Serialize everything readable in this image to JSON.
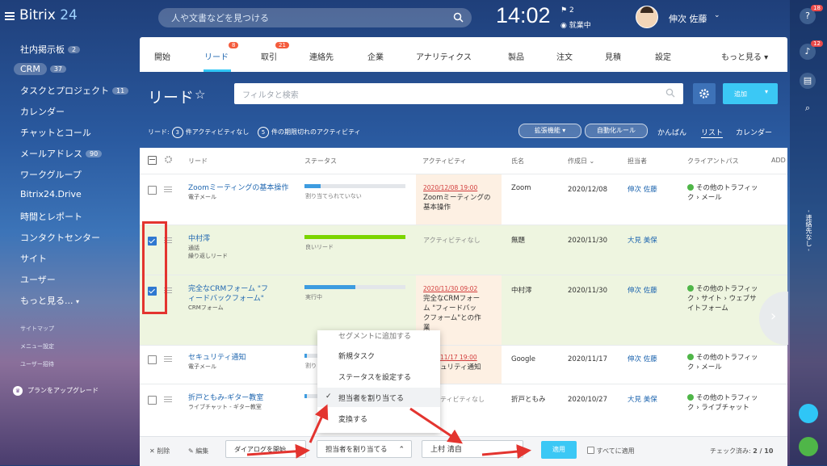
{
  "colors": {
    "accent": "#2fc6f6",
    "link": "#2067b0",
    "badge": "#f45b3c",
    "annotation": "#e3342f"
  },
  "topbar": {
    "app_name": "Bitrix",
    "app_version": "24",
    "search_placeholder": "人や文書などを見つける",
    "clock": "14:02",
    "flag_count": "2",
    "work_status": "就業中",
    "user_name": "伸次 佐藤"
  },
  "sidebar": {
    "items": [
      {
        "label": "社内掲示板",
        "count": "2"
      },
      {
        "label": "CRM",
        "count": "37"
      },
      {
        "label": "タスクとプロジェクト",
        "count": "11"
      },
      {
        "label": "カレンダー",
        "count": ""
      },
      {
        "label": "チャットとコール",
        "count": ""
      },
      {
        "label": "メールアドレス",
        "count": "90"
      },
      {
        "label": "ワークグループ",
        "count": ""
      },
      {
        "label": "Bitrix24.Drive",
        "count": ""
      },
      {
        "label": "時間とレポート",
        "count": ""
      },
      {
        "label": "コンタクトセンター",
        "count": ""
      },
      {
        "label": "サイト",
        "count": ""
      },
      {
        "label": "ユーザー",
        "count": ""
      },
      {
        "label": "もっと見る...",
        "count": ""
      }
    ],
    "sitemap": "サイトマップ",
    "menu_settings": "メニュー設定",
    "user_invite": "ユーザー招待",
    "upgrade": "プランをアップグレード"
  },
  "rightbar": {
    "help_count": "18",
    "notify_count": "12",
    "vertical_label": "- 連絡先なし -"
  },
  "tabs": [
    {
      "label": "開始",
      "badge": ""
    },
    {
      "label": "リード",
      "badge": "8"
    },
    {
      "label": "取引",
      "badge": "21"
    },
    {
      "label": "連絡先",
      "badge": ""
    },
    {
      "label": "企業",
      "badge": ""
    },
    {
      "label": "アナリティクス",
      "badge": ""
    },
    {
      "label": "製品",
      "badge": ""
    },
    {
      "label": "注文",
      "badge": ""
    },
    {
      "label": "見積",
      "badge": ""
    },
    {
      "label": "設定",
      "badge": ""
    },
    {
      "label": "もっと見る",
      "badge": ""
    }
  ],
  "header": {
    "title": "リード",
    "filter_placeholder": "フィルタと検索",
    "add_label": "追加"
  },
  "info": {
    "prefix": "リード:",
    "no_activity_count": "3",
    "no_activity_text": "件アクティビティなし",
    "overdue_count": "5",
    "overdue_text": "件の期限切れのアクティビティ"
  },
  "toolbar": {
    "extensions": "拡張機能",
    "automation": "自動化ルール",
    "view_kanban": "かんばん",
    "view_list": "リスト",
    "view_calendar": "カレンダー"
  },
  "table": {
    "columns": [
      "リード",
      "ステータス",
      "アクティビティ",
      "氏名",
      "作成日",
      "担当者",
      "クライアントパス",
      "ADD"
    ],
    "rows": [
      {
        "name": "Zoomミーティングの基本操作",
        "source": "電子メール",
        "sub": "",
        "status": "割り当てられていない",
        "progress": 0.16,
        "activity_date": "2020/12/08 19:00",
        "activity_text": "Zoomミーティングの基本操作",
        "person": "Zoom",
        "created": "2020/12/08",
        "owner": "伸次 佐藤",
        "path": "その他のトラフィック › メール",
        "checked": false
      },
      {
        "name": "中村澪",
        "source": "通話",
        "sub": "繰り返しリード",
        "status": "良いリード",
        "progress": 1.0,
        "activity_date": "",
        "activity_text": "アクティビティなし",
        "person": "無題",
        "created": "2020/11/30",
        "owner": "大見 美保",
        "path": "",
        "checked": true
      },
      {
        "name": "完全なCRMフォーム \"フィードバックフォーム\"",
        "source": "CRMフォーム",
        "sub": "",
        "status": "実行中",
        "progress": 0.5,
        "activity_date": "2020/11/30 09:02",
        "activity_text": "完全なCRMフォーム \"フィードバックフォーム\"との作業",
        "person": "中村澪",
        "created": "2020/11/30",
        "owner": "伸次 佐藤",
        "path": "その他のトラフィック › サイト › ウェブサイトフォーム",
        "checked": true
      },
      {
        "name": "セキュリティ通知",
        "source": "電子メール",
        "sub": "",
        "status": "割り",
        "progress": 0.16,
        "activity_date": "11/17 19:00",
        "activity_text": "ュリティ通知",
        "person": "Google",
        "created": "2020/11/17",
        "owner": "伸次 佐藤",
        "path": "その他のトラフィック › メール",
        "checked": false
      },
      {
        "name": "折戸ともみ-ギター教室",
        "source": "ライブチャット - ギター教室",
        "sub": "",
        "status": "",
        "progress": 0.16,
        "activity_date": "",
        "activity_text": "ティビティなし",
        "person": "折戸ともみ",
        "created": "2020/10/27",
        "owner": "大見 美保",
        "path": "その他のトラフィック › ライブチャット",
        "checked": false
      }
    ]
  },
  "action_menu": {
    "items": [
      "セグメントに追加する",
      "新規タスク",
      "ステータスを設定する",
      "担当者を割り当てる",
      "変換する"
    ],
    "selected": "担当者を割り当てる"
  },
  "bottombar": {
    "delete": "削除",
    "edit": "編集",
    "dialog": "ダイアログを開始",
    "action_select": "担当者を割り当てる",
    "assignee_input": "上村 清自",
    "apply": "適用",
    "apply_all": "すべてに適用",
    "checked_label": "チェック済み:",
    "checked_value": "2 / 10"
  }
}
